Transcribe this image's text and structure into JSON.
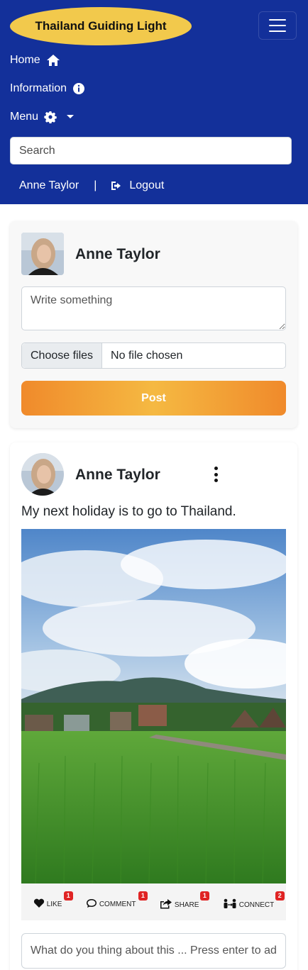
{
  "navbar": {
    "brand": "Thailand Guiding Light",
    "links": [
      {
        "label": "Home",
        "icon": "home-icon"
      },
      {
        "label": "Information",
        "icon": "info-icon"
      },
      {
        "label": "Menu",
        "icon": "gear-icon"
      }
    ],
    "search_placeholder": "Search",
    "user_name": "Anne Taylor",
    "separator": "|",
    "logout_label": "Logout"
  },
  "composer": {
    "user_name": "Anne Taylor",
    "text_placeholder": "Write something",
    "file_button": "Choose files",
    "file_status": "No file chosen",
    "post_label": "Post"
  },
  "post": {
    "user_name": "Anne Taylor",
    "text": "My next holiday is to go to Thailand.",
    "actions": [
      {
        "label": "LIKE",
        "count": "1",
        "icon": "heart-icon"
      },
      {
        "label": "COMMENT",
        "count": "1",
        "icon": "comment-icon"
      },
      {
        "label": "SHARE",
        "count": "1",
        "icon": "share-icon"
      },
      {
        "label": "CONNECT",
        "count": "2",
        "icon": "connect-icon"
      }
    ],
    "comment_placeholder": "What do you thing about this ... Press enter to add"
  },
  "colors": {
    "navbar_bg": "#13309a",
    "brand_bg": "#f2c94c",
    "post_button": "#f08a2b",
    "badge": "#e02424"
  }
}
